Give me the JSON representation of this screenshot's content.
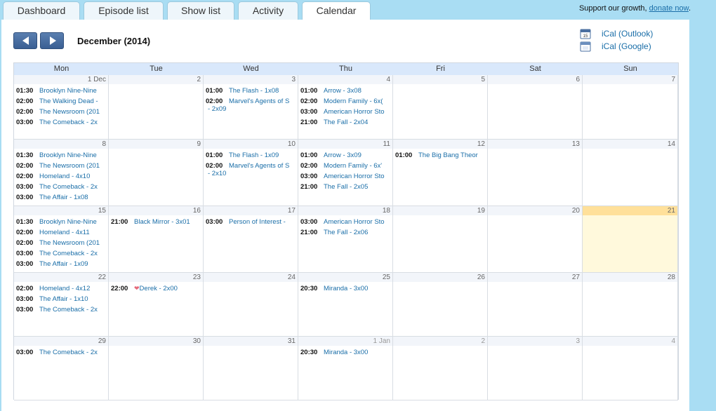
{
  "tabs": [
    "Dashboard",
    "Episode list",
    "Show list",
    "Activity",
    "Calendar"
  ],
  "active_tab": 4,
  "support": {
    "text": "Support our growth,",
    "link": "donate now",
    "tail": "."
  },
  "month_title": "December (2014)",
  "ical": [
    {
      "label": "iCal (Outlook)",
      "icon": "ical-outlook-icon"
    },
    {
      "label": "iCal (Google)",
      "icon": "ical-google-icon"
    }
  ],
  "weekdays": [
    "Mon",
    "Tue",
    "Wed",
    "Thu",
    "Fri",
    "Sat",
    "Sun"
  ],
  "weeks": [
    [
      {
        "day": "1 Dec",
        "events": [
          {
            "time": "01:30",
            "show": "Brooklyn Nine-Nine",
            "ep": ""
          },
          {
            "time": "02:00",
            "show": "The Walking Dead",
            "ep": "-"
          },
          {
            "time": "02:00",
            "show": "The Newsroom (201",
            "ep": ""
          },
          {
            "time": "03:00",
            "show": "The Comeback",
            "ep": "- 2x"
          }
        ]
      },
      {
        "day": "2",
        "events": []
      },
      {
        "day": "3",
        "events": [
          {
            "time": "01:00",
            "show": "The Flash",
            "ep": "- 1x08"
          },
          {
            "time": "02:00",
            "show": "Marvel's Agents of S",
            "ep": "",
            "wrap": "- 2x09"
          }
        ]
      },
      {
        "day": "4",
        "events": [
          {
            "time": "01:00",
            "show": "Arrow",
            "ep": "- 3x08"
          },
          {
            "time": "02:00",
            "show": "Modern Family",
            "ep": "- 6x("
          },
          {
            "time": "03:00",
            "show": "American Horror Sto",
            "ep": ""
          },
          {
            "time": "21:00",
            "show": "The Fall",
            "ep": "- 2x04"
          }
        ]
      },
      {
        "day": "5",
        "events": []
      },
      {
        "day": "6",
        "events": []
      },
      {
        "day": "7",
        "events": []
      }
    ],
    [
      {
        "day": "8",
        "events": [
          {
            "time": "01:30",
            "show": "Brooklyn Nine-Nine",
            "ep": ""
          },
          {
            "time": "02:00",
            "show": "The Newsroom (201",
            "ep": ""
          },
          {
            "time": "02:00",
            "show": "Homeland",
            "ep": "- 4x10"
          },
          {
            "time": "03:00",
            "show": "The Comeback",
            "ep": "- 2x"
          },
          {
            "time": "03:00",
            "show": "The Affair",
            "ep": "- 1x08"
          }
        ]
      },
      {
        "day": "9",
        "events": []
      },
      {
        "day": "10",
        "events": [
          {
            "time": "01:00",
            "show": "The Flash",
            "ep": "- 1x09"
          },
          {
            "time": "02:00",
            "show": "Marvel's Agents of S",
            "ep": "",
            "wrap": "- 2x10"
          }
        ]
      },
      {
        "day": "11",
        "events": [
          {
            "time": "01:00",
            "show": "Arrow",
            "ep": "- 3x09"
          },
          {
            "time": "02:00",
            "show": "Modern Family",
            "ep": "- 6x'"
          },
          {
            "time": "03:00",
            "show": "American Horror Sto",
            "ep": ""
          },
          {
            "time": "21:00",
            "show": "The Fall",
            "ep": "- 2x05"
          }
        ]
      },
      {
        "day": "12",
        "events": [
          {
            "time": "01:00",
            "show": "The Big Bang Theor",
            "ep": ""
          }
        ]
      },
      {
        "day": "13",
        "events": []
      },
      {
        "day": "14",
        "events": []
      }
    ],
    [
      {
        "day": "15",
        "events": [
          {
            "time": "01:30",
            "show": "Brooklyn Nine-Nine",
            "ep": ""
          },
          {
            "time": "02:00",
            "show": "Homeland",
            "ep": "- 4x11"
          },
          {
            "time": "02:00",
            "show": "The Newsroom (201",
            "ep": ""
          },
          {
            "time": "03:00",
            "show": "The Comeback",
            "ep": "- 2x"
          },
          {
            "time": "03:00",
            "show": "The Affair",
            "ep": "- 1x09"
          }
        ]
      },
      {
        "day": "16",
        "events": [
          {
            "time": "21:00",
            "show": "Black Mirror",
            "ep": "- 3x01"
          }
        ]
      },
      {
        "day": "17",
        "events": [
          {
            "time": "03:00",
            "show": "Person of Interest",
            "ep": "-"
          }
        ]
      },
      {
        "day": "18",
        "events": [
          {
            "time": "03:00",
            "show": "American Horror Sto",
            "ep": ""
          },
          {
            "time": "21:00",
            "show": "The Fall",
            "ep": "- 2x06"
          }
        ]
      },
      {
        "day": "19",
        "events": []
      },
      {
        "day": "20",
        "events": []
      },
      {
        "day": "21",
        "events": [],
        "today": true
      }
    ],
    [
      {
        "day": "22",
        "events": [
          {
            "time": "02:00",
            "show": "Homeland",
            "ep": "- 4x12"
          },
          {
            "time": "03:00",
            "show": "The Affair",
            "ep": "- 1x10"
          },
          {
            "time": "03:00",
            "show": "The Comeback",
            "ep": "- 2x"
          }
        ]
      },
      {
        "day": "23",
        "events": [
          {
            "time": "22:00",
            "show": "Derek",
            "ep": "- 2x00",
            "heart": true
          }
        ]
      },
      {
        "day": "24",
        "events": []
      },
      {
        "day": "25",
        "events": [
          {
            "time": "20:30",
            "show": "Miranda",
            "ep": "- 3x00"
          }
        ]
      },
      {
        "day": "26",
        "events": []
      },
      {
        "day": "27",
        "events": []
      },
      {
        "day": "28",
        "events": []
      }
    ],
    [
      {
        "day": "29",
        "events": [
          {
            "time": "03:00",
            "show": "The Comeback",
            "ep": "- 2x"
          }
        ]
      },
      {
        "day": "30",
        "events": []
      },
      {
        "day": "31",
        "events": []
      },
      {
        "day": "1 Jan",
        "events": [
          {
            "time": "20:30",
            "show": "Miranda",
            "ep": "- 3x00"
          }
        ],
        "other": true
      },
      {
        "day": "2",
        "events": [],
        "other": true
      },
      {
        "day": "3",
        "events": [],
        "other": true
      },
      {
        "day": "4",
        "events": [],
        "other": true
      }
    ]
  ]
}
